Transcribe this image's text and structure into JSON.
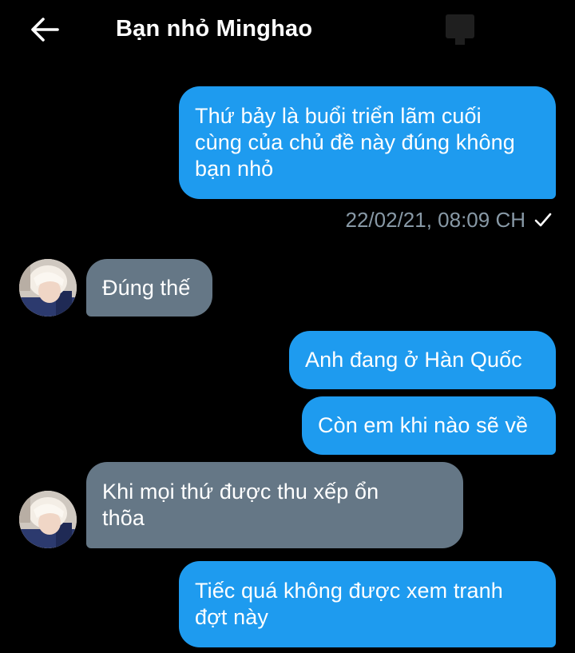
{
  "header": {
    "title": "Bạn nhỏ Minghao",
    "back_icon": "arrow-left-icon"
  },
  "colors": {
    "background": "#000000",
    "sent_bubble": "#1e9bef",
    "received_bubble": "#657786",
    "timestamp": "#8899a6"
  },
  "messages": [
    {
      "direction": "sent",
      "text": "Thứ bảy là buổi triển lãm cuối\ncùng của chủ đề này đúng không\nbạn nhỏ"
    },
    {
      "direction": "received",
      "text": "Đúng thế"
    },
    {
      "direction": "sent",
      "text": "Anh đang ở Hàn Quốc"
    },
    {
      "direction": "sent",
      "text": "Còn em khi nào sẽ về"
    },
    {
      "direction": "received",
      "text": "Khi mọi thứ được thu xếp ổn\nthõa"
    },
    {
      "direction": "sent",
      "text": "Tiếc quá không được xem tranh\nđợt này"
    }
  ],
  "timestamp": {
    "text": "22/02/21, 08:09 CH",
    "icon": "check-icon"
  }
}
